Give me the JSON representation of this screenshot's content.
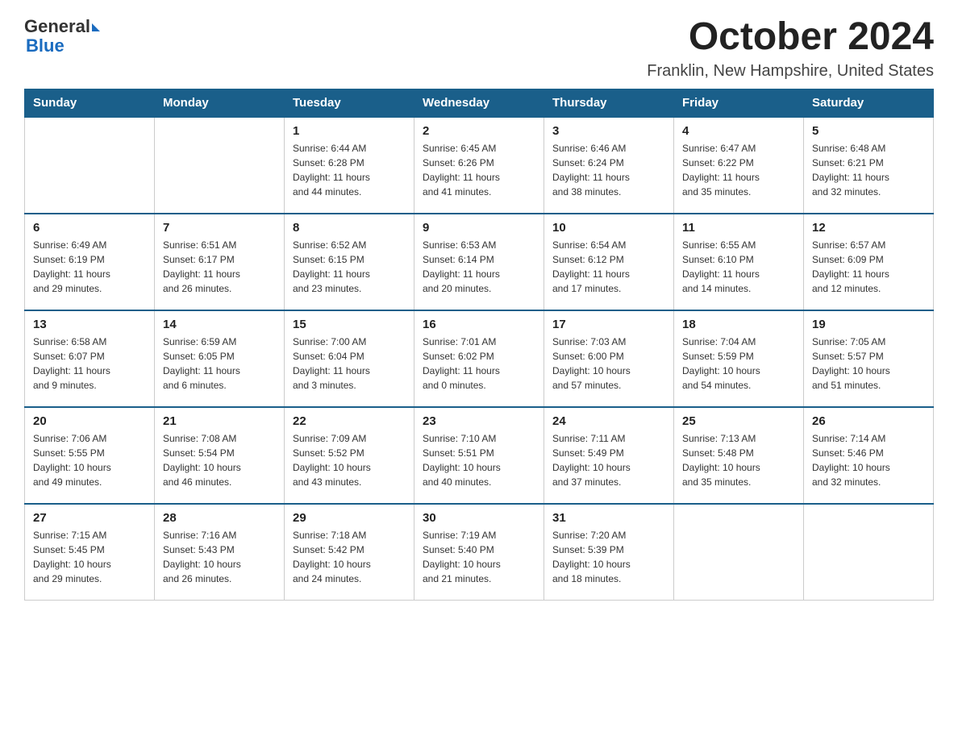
{
  "logo": {
    "general": "General",
    "blue": "Blue"
  },
  "title": "October 2024",
  "subtitle": "Franklin, New Hampshire, United States",
  "headers": [
    "Sunday",
    "Monday",
    "Tuesday",
    "Wednesday",
    "Thursday",
    "Friday",
    "Saturday"
  ],
  "weeks": [
    [
      {
        "day": "",
        "info": ""
      },
      {
        "day": "",
        "info": ""
      },
      {
        "day": "1",
        "info": "Sunrise: 6:44 AM\nSunset: 6:28 PM\nDaylight: 11 hours\nand 44 minutes."
      },
      {
        "day": "2",
        "info": "Sunrise: 6:45 AM\nSunset: 6:26 PM\nDaylight: 11 hours\nand 41 minutes."
      },
      {
        "day": "3",
        "info": "Sunrise: 6:46 AM\nSunset: 6:24 PM\nDaylight: 11 hours\nand 38 minutes."
      },
      {
        "day": "4",
        "info": "Sunrise: 6:47 AM\nSunset: 6:22 PM\nDaylight: 11 hours\nand 35 minutes."
      },
      {
        "day": "5",
        "info": "Sunrise: 6:48 AM\nSunset: 6:21 PM\nDaylight: 11 hours\nand 32 minutes."
      }
    ],
    [
      {
        "day": "6",
        "info": "Sunrise: 6:49 AM\nSunset: 6:19 PM\nDaylight: 11 hours\nand 29 minutes."
      },
      {
        "day": "7",
        "info": "Sunrise: 6:51 AM\nSunset: 6:17 PM\nDaylight: 11 hours\nand 26 minutes."
      },
      {
        "day": "8",
        "info": "Sunrise: 6:52 AM\nSunset: 6:15 PM\nDaylight: 11 hours\nand 23 minutes."
      },
      {
        "day": "9",
        "info": "Sunrise: 6:53 AM\nSunset: 6:14 PM\nDaylight: 11 hours\nand 20 minutes."
      },
      {
        "day": "10",
        "info": "Sunrise: 6:54 AM\nSunset: 6:12 PM\nDaylight: 11 hours\nand 17 minutes."
      },
      {
        "day": "11",
        "info": "Sunrise: 6:55 AM\nSunset: 6:10 PM\nDaylight: 11 hours\nand 14 minutes."
      },
      {
        "day": "12",
        "info": "Sunrise: 6:57 AM\nSunset: 6:09 PM\nDaylight: 11 hours\nand 12 minutes."
      }
    ],
    [
      {
        "day": "13",
        "info": "Sunrise: 6:58 AM\nSunset: 6:07 PM\nDaylight: 11 hours\nand 9 minutes."
      },
      {
        "day": "14",
        "info": "Sunrise: 6:59 AM\nSunset: 6:05 PM\nDaylight: 11 hours\nand 6 minutes."
      },
      {
        "day": "15",
        "info": "Sunrise: 7:00 AM\nSunset: 6:04 PM\nDaylight: 11 hours\nand 3 minutes."
      },
      {
        "day": "16",
        "info": "Sunrise: 7:01 AM\nSunset: 6:02 PM\nDaylight: 11 hours\nand 0 minutes."
      },
      {
        "day": "17",
        "info": "Sunrise: 7:03 AM\nSunset: 6:00 PM\nDaylight: 10 hours\nand 57 minutes."
      },
      {
        "day": "18",
        "info": "Sunrise: 7:04 AM\nSunset: 5:59 PM\nDaylight: 10 hours\nand 54 minutes."
      },
      {
        "day": "19",
        "info": "Sunrise: 7:05 AM\nSunset: 5:57 PM\nDaylight: 10 hours\nand 51 minutes."
      }
    ],
    [
      {
        "day": "20",
        "info": "Sunrise: 7:06 AM\nSunset: 5:55 PM\nDaylight: 10 hours\nand 49 minutes."
      },
      {
        "day": "21",
        "info": "Sunrise: 7:08 AM\nSunset: 5:54 PM\nDaylight: 10 hours\nand 46 minutes."
      },
      {
        "day": "22",
        "info": "Sunrise: 7:09 AM\nSunset: 5:52 PM\nDaylight: 10 hours\nand 43 minutes."
      },
      {
        "day": "23",
        "info": "Sunrise: 7:10 AM\nSunset: 5:51 PM\nDaylight: 10 hours\nand 40 minutes."
      },
      {
        "day": "24",
        "info": "Sunrise: 7:11 AM\nSunset: 5:49 PM\nDaylight: 10 hours\nand 37 minutes."
      },
      {
        "day": "25",
        "info": "Sunrise: 7:13 AM\nSunset: 5:48 PM\nDaylight: 10 hours\nand 35 minutes."
      },
      {
        "day": "26",
        "info": "Sunrise: 7:14 AM\nSunset: 5:46 PM\nDaylight: 10 hours\nand 32 minutes."
      }
    ],
    [
      {
        "day": "27",
        "info": "Sunrise: 7:15 AM\nSunset: 5:45 PM\nDaylight: 10 hours\nand 29 minutes."
      },
      {
        "day": "28",
        "info": "Sunrise: 7:16 AM\nSunset: 5:43 PM\nDaylight: 10 hours\nand 26 minutes."
      },
      {
        "day": "29",
        "info": "Sunrise: 7:18 AM\nSunset: 5:42 PM\nDaylight: 10 hours\nand 24 minutes."
      },
      {
        "day": "30",
        "info": "Sunrise: 7:19 AM\nSunset: 5:40 PM\nDaylight: 10 hours\nand 21 minutes."
      },
      {
        "day": "31",
        "info": "Sunrise: 7:20 AM\nSunset: 5:39 PM\nDaylight: 10 hours\nand 18 minutes."
      },
      {
        "day": "",
        "info": ""
      },
      {
        "day": "",
        "info": ""
      }
    ]
  ]
}
